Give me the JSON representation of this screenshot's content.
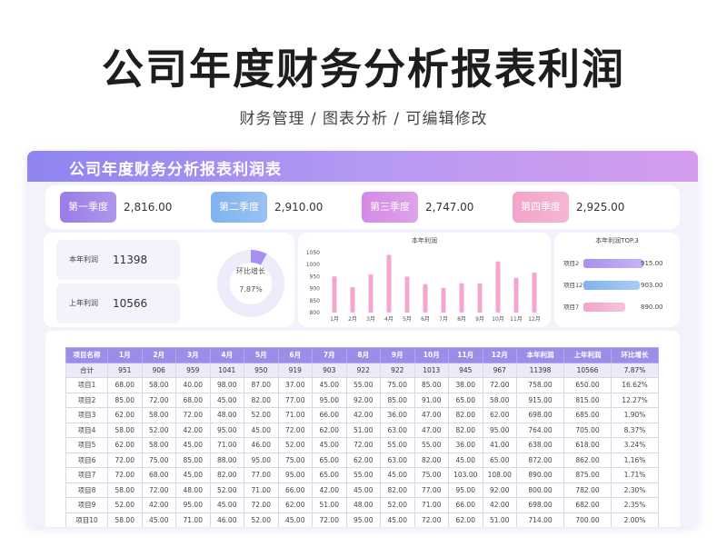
{
  "hero": {
    "title": "公司年度财务分析报表利润",
    "subtitle": "财务管理 / 图表分析 /  可编辑修改"
  },
  "sheet": {
    "title": "公司年度财务分析报表利润表"
  },
  "quarters": [
    {
      "label": "第一季度",
      "value": "2,816.00",
      "color": "#9a7be8"
    },
    {
      "label": "第二季度",
      "value": "2,910.00",
      "color": "#7fb2f0"
    },
    {
      "label": "第三季度",
      "value": "2,747.00",
      "color": "#d58ae6"
    },
    {
      "label": "第四季度",
      "value": "2,925.00",
      "color": "#f3a3c9"
    }
  ],
  "profit": {
    "this_year_label": "本年利润",
    "this_year_value": "11398",
    "last_year_label": "上年利润",
    "last_year_value": "10566",
    "growth_label": "环比增长",
    "growth_value": "7.87%",
    "growth_fraction": 0.0787,
    "donut_color": "#a98ff0",
    "donut_track_color": "#eeebfb"
  },
  "chart_data": [
    {
      "type": "bar",
      "title": "本年利润",
      "categories": [
        "1月",
        "2月",
        "3月",
        "4月",
        "5月",
        "6月",
        "7月",
        "8月",
        "9月",
        "10月",
        "11月",
        "12月"
      ],
      "values": [
        951,
        906,
        959,
        1041,
        950,
        919,
        903,
        922,
        922,
        1013,
        945,
        967
      ],
      "yticks": [
        800,
        850,
        900,
        950,
        1000,
        1050
      ],
      "ylim": [
        800,
        1050
      ],
      "bar_color": "#f4a6d0"
    },
    {
      "type": "bar",
      "title": "本年利润TOP.3",
      "categories": [
        "项目2",
        "项目12",
        "项目7"
      ],
      "values": [
        915.0,
        903.0,
        890.0
      ],
      "value_labels": [
        "915.00",
        "903.00",
        "890.00"
      ],
      "colors": [
        "#a98ff0",
        "#7fb2f0",
        "#f3a3c9"
      ],
      "xlim": [
        0,
        915
      ]
    }
  ],
  "table": {
    "headers": [
      "项目名称",
      "1月",
      "2月",
      "3月",
      "4月",
      "5月",
      "6月",
      "7月",
      "8月",
      "9月",
      "10月",
      "11月",
      "12月",
      "本年利润",
      "上年利润",
      "环比增长"
    ],
    "total": [
      "合计",
      "951",
      "906",
      "959",
      "1041",
      "950",
      "919",
      "903",
      "922",
      "922",
      "1013",
      "945",
      "967",
      "11398",
      "10566",
      "7.87%"
    ],
    "rows": [
      [
        "项目1",
        "68.00",
        "58.00",
        "40.00",
        "98.00",
        "87.00",
        "37.00",
        "45.00",
        "55.00",
        "75.00",
        "85.00",
        "38.00",
        "72.00",
        "758.00",
        "650.00",
        "16.62%"
      ],
      [
        "项目2",
        "85.00",
        "72.00",
        "68.00",
        "45.00",
        "82.00",
        "77.00",
        "95.00",
        "92.00",
        "85.00",
        "91.00",
        "65.00",
        "58.00",
        "915.00",
        "815.00",
        "12.27%"
      ],
      [
        "项目3",
        "62.00",
        "58.00",
        "72.00",
        "48.00",
        "52.00",
        "71.00",
        "66.00",
        "42.00",
        "36.00",
        "47.00",
        "82.00",
        "62.00",
        "698.00",
        "685.00",
        "1.90%"
      ],
      [
        "项目4",
        "58.00",
        "52.00",
        "42.00",
        "95.00",
        "45.00",
        "72.00",
        "62.00",
        "51.00",
        "63.00",
        "47.00",
        "82.00",
        "95.00",
        "764.00",
        "705.00",
        "8.37%"
      ],
      [
        "项目5",
        "62.00",
        "58.00",
        "45.00",
        "71.00",
        "46.00",
        "52.00",
        "45.00",
        "72.00",
        "55.00",
        "55.00",
        "36.00",
        "41.00",
        "638.00",
        "618.00",
        "3.24%"
      ],
      [
        "项目6",
        "72.00",
        "75.00",
        "85.00",
        "88.00",
        "95.00",
        "75.00",
        "65.00",
        "62.00",
        "63.00",
        "82.00",
        "45.00",
        "65.00",
        "872.00",
        "862.00",
        "1.16%"
      ],
      [
        "项目7",
        "72.00",
        "68.00",
        "45.00",
        "82.00",
        "77.00",
        "95.00",
        "65.00",
        "55.00",
        "45.00",
        "75.00",
        "103.00",
        "108.00",
        "890.00",
        "875.00",
        "1.71%"
      ],
      [
        "项目8",
        "58.00",
        "72.00",
        "48.00",
        "52.00",
        "71.00",
        "66.00",
        "42.00",
        "45.00",
        "82.00",
        "77.00",
        "95.00",
        "92.00",
        "800.00",
        "782.00",
        "2.30%"
      ],
      [
        "项目9",
        "52.00",
        "42.00",
        "95.00",
        "45.00",
        "72.00",
        "62.00",
        "51.00",
        "48.00",
        "52.00",
        "71.00",
        "66.00",
        "42.00",
        "698.00",
        "682.00",
        "2.35%"
      ],
      [
        "项目10",
        "58.00",
        "45.00",
        "71.00",
        "46.00",
        "52.00",
        "45.00",
        "72.00",
        "95.00",
        "45.00",
        "72.00",
        "62.00",
        "51.00",
        "714.00",
        "700.00",
        "2.00%"
      ]
    ]
  }
}
